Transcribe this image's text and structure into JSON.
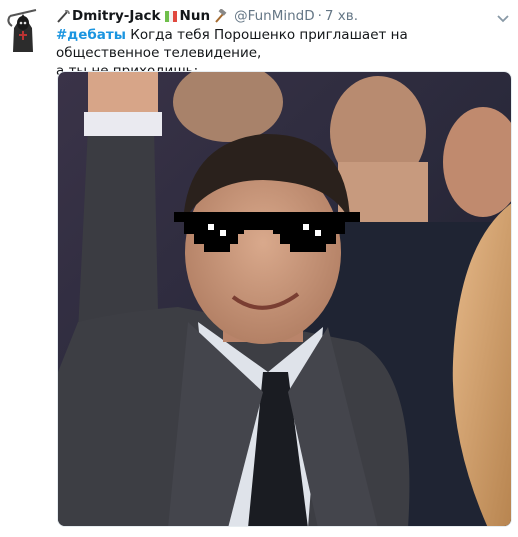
{
  "tweet": {
    "author": {
      "display_name_part1": "Dmitry-Jack",
      "display_name_part2": "Nun",
      "handle": "@FunMindD",
      "avatar_icon": "grim-reaper-avatar-icon",
      "name_icons": [
        "scythe-icon",
        "pepe-icon",
        "hammer-icon"
      ]
    },
    "separator": "·",
    "time": "7 хв.",
    "hashtag": "#дебаты",
    "body_line1": " Когда тебя Порошенко приглашает на общественное телевидение,",
    "body_line2": "а ты не приходишь:",
    "media": {
      "type": "photo",
      "description_icon": "deal-with-it-sunglasses-icon"
    }
  },
  "colors": {
    "text": "#14171a",
    "secondary": "#657786",
    "link": "#1b95e0",
    "background": "#ffffff"
  }
}
